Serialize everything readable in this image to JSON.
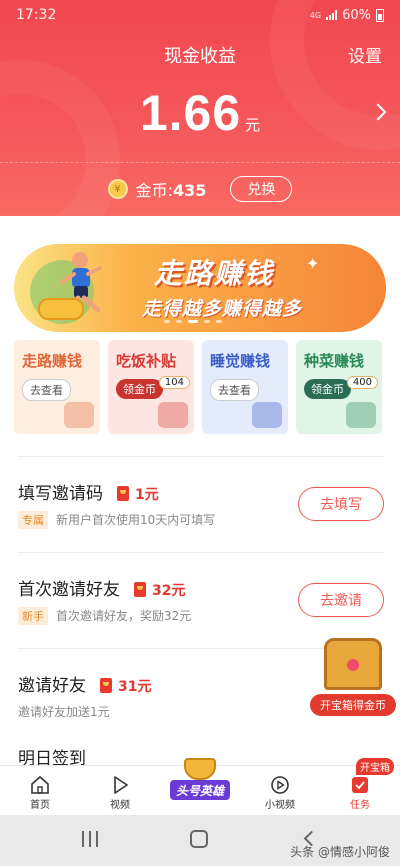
{
  "status": {
    "time": "17:32",
    "network": "4G",
    "battery": "60%"
  },
  "header": {
    "title": "现金收益",
    "settings": "设置",
    "amount": "1.66",
    "unit": "元"
  },
  "coins": {
    "icon_char": "¥",
    "label": "金币:",
    "value": "435",
    "exchange": "兑换"
  },
  "banner": {
    "title": "走路赚钱",
    "subtitle": "走得越多赚得越多"
  },
  "tiles": [
    {
      "title": "走路赚钱",
      "button": "去查看",
      "color": "#e0683a",
      "bg": "#fdeee0",
      "btnstyle": "outline"
    },
    {
      "title": "吃饭补贴",
      "button": "领金币",
      "badge": "104",
      "color": "#d83a36",
      "bg": "#fde6e2",
      "btnstyle": "solid",
      "btncolor": "#c8342f"
    },
    {
      "title": "睡觉赚钱",
      "button": "去查看",
      "color": "#3c5cc9",
      "bg": "#e4ecfc",
      "btnstyle": "outline"
    },
    {
      "title": "种菜赚钱",
      "button": "领金币",
      "badge": "400",
      "color": "#2a8a55",
      "bg": "#e0f4e8",
      "btnstyle": "solid",
      "btncolor": "#2a6e56"
    }
  ],
  "tasks": [
    {
      "title": "填写邀请码",
      "reward": "1元",
      "tag": "专属",
      "desc": "新用户首次使用10天内可填写",
      "action": "去填写"
    },
    {
      "title": "首次邀请好友",
      "reward": "32元",
      "tag": "新手",
      "desc": "首次邀请好友，奖励32元",
      "action": "去邀请"
    },
    {
      "title": "邀请好友",
      "reward": "31元",
      "tag": "",
      "desc": "邀请好友加送1元",
      "action": ""
    }
  ],
  "partial_row": "明日签到",
  "chest": {
    "label": "开宝箱得金币"
  },
  "tabbar": {
    "items": [
      {
        "label": "首页"
      },
      {
        "label": "视频"
      },
      {
        "label": ""
      },
      {
        "label": "小视频"
      },
      {
        "label": "任务"
      }
    ],
    "center_logo": "头号英雄",
    "badge": "开宝箱"
  },
  "watermark": "头条 @情感小阿俊",
  "colors": {
    "accent": "#f2484f",
    "reward": "#e3382f"
  }
}
